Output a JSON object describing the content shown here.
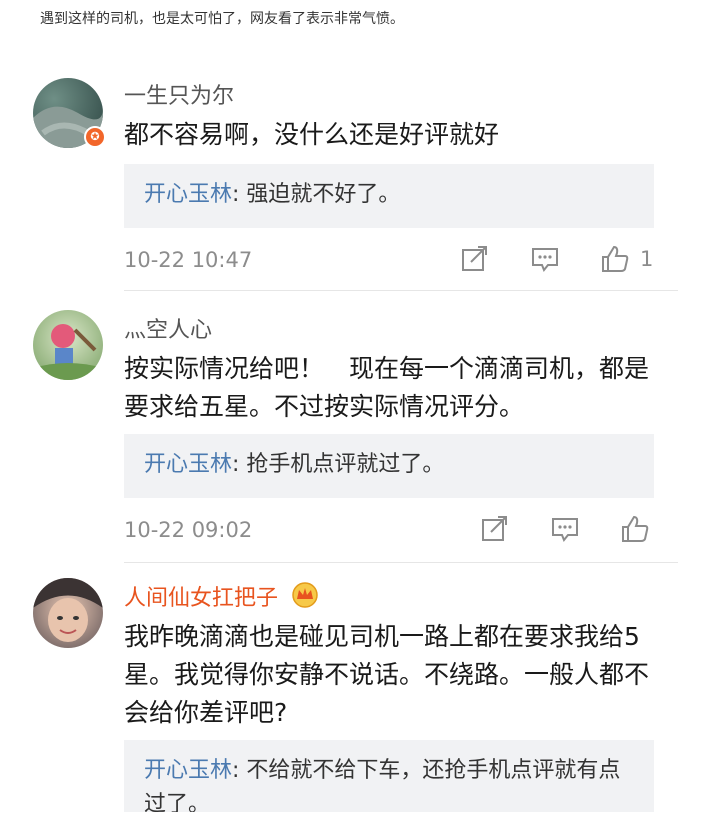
{
  "caption": "遇到这样的司机，也是太可怕了，网友看了表示非常气愤。",
  "comments": [
    {
      "username": "一生只为尔",
      "text": "都不容易啊，没什么还是好评就好",
      "reply_name": "开心玉林",
      "reply_text": ": 强迫就不好了。",
      "time": "10-22 10:47",
      "likes": "1"
    },
    {
      "username": "灬空人心",
      "text": "按实际情况给吧！　现在每一个滴滴司机，都是要求给五星。不过按实际情况评分。",
      "reply_name": "开心玉林",
      "reply_text": ": 抢手机点评就过了。",
      "time": "10-22 09:02",
      "likes": ""
    },
    {
      "username": "人间仙女扛把子",
      "text": "我昨晚滴滴也是碰见司机一路上都在要求我给5星。我觉得你安静不说话。不绕路。一般人都不会给你差评吧?",
      "reply_name": "开心玉林",
      "reply_text": ": 不给就不给下车，还抢手机点评就有点过了。",
      "time": "",
      "likes": ""
    }
  ],
  "icons": {
    "share": "share-icon",
    "reply": "comment-icon",
    "like": "thumbs-up-icon",
    "verified": "verified-badge-icon",
    "crown": "crown-icon"
  },
  "colors": {
    "reply_name": "#4b7ab0",
    "vip_name": "#e8541f",
    "badge": "#f2662a",
    "reply_bg": "#f1f2f4"
  }
}
